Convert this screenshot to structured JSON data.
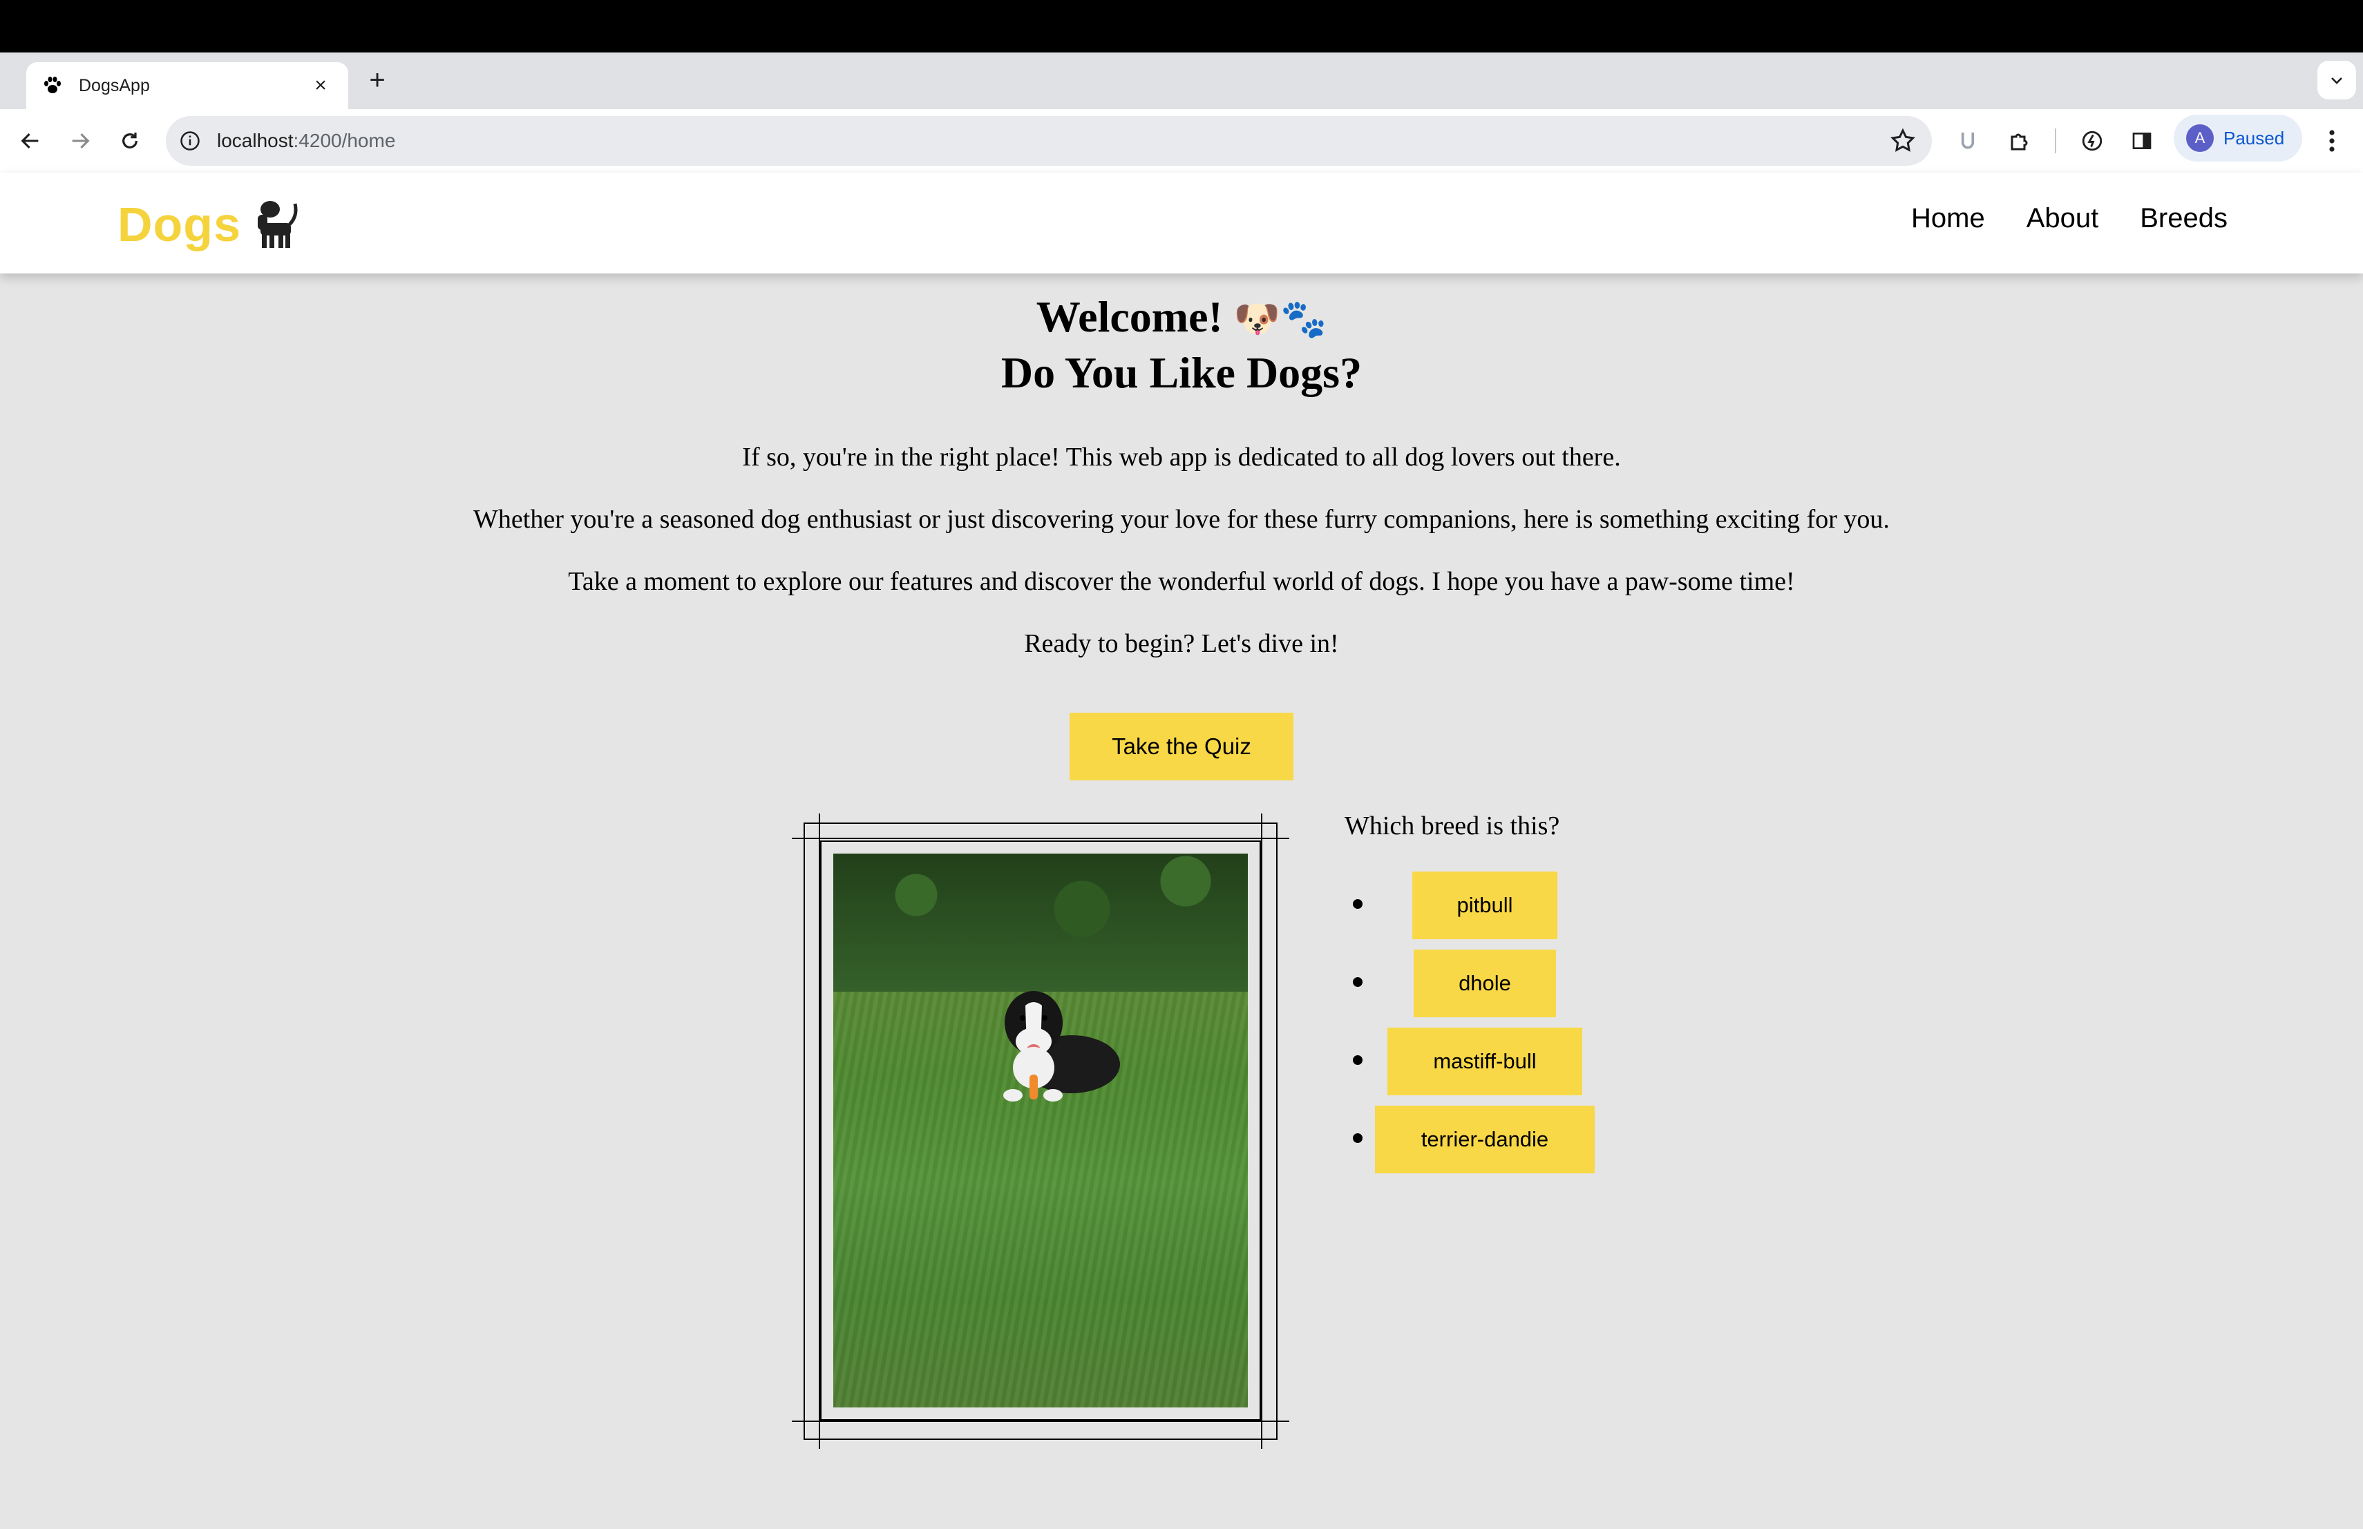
{
  "browser": {
    "tab_title": "DogsApp",
    "new_tab_label": "+",
    "close_label": "×",
    "url_host": "localhost",
    "url_rest": ":4200/home",
    "profile_initial": "A",
    "profile_status": "Paused"
  },
  "header": {
    "brand": "Dogs",
    "nav": [
      "Home",
      "About",
      "Breeds"
    ]
  },
  "hero": {
    "title_line1": "Welcome!",
    "title_emoji": "🐶🐾",
    "title_line2": "Do You Like Dogs?"
  },
  "intro": [
    "If so, you're in the right place! This web app is dedicated to all dog lovers out there.",
    "Whether you're a seasoned dog enthusiast or just discovering your love for these furry companions, here is something exciting for you.",
    "Take a moment to explore our features and discover the wonderful world of dogs. I hope you have a paw-some time!",
    "Ready to begin? Let's dive in!"
  ],
  "quiz": {
    "button_label": "Take the Quiz",
    "question": "Which breed is this?",
    "answers": [
      "pitbull",
      "dhole",
      "mastiff-bull",
      "terrier-dandie"
    ]
  },
  "colors": {
    "accent": "#f8d846",
    "page_bg": "#e5e5e5"
  }
}
